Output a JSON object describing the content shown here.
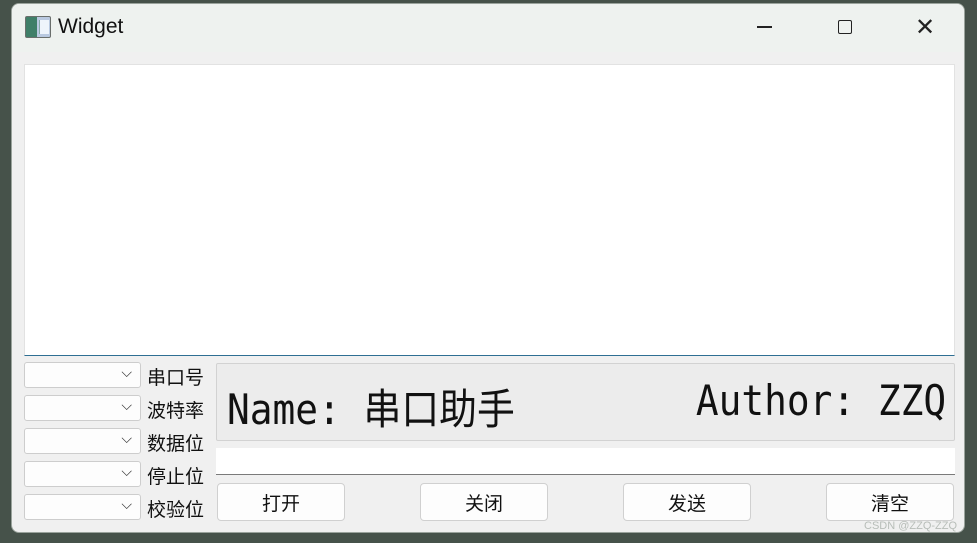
{
  "window": {
    "title": "Widget",
    "controls": {
      "minimize": "minimize-icon",
      "maximize": "maximize-icon",
      "close": "close-icon"
    }
  },
  "receive_area": {
    "value": ""
  },
  "settings": [
    {
      "label": "串口号",
      "value": ""
    },
    {
      "label": "波特率",
      "value": ""
    },
    {
      "label": "数据位",
      "value": ""
    },
    {
      "label": "停止位",
      "value": ""
    },
    {
      "label": "校验位",
      "value": ""
    }
  ],
  "banner": {
    "name": "Name: 串口助手",
    "author": "Author: ZZQ"
  },
  "send_input": {
    "value": ""
  },
  "buttons": {
    "open": "打开",
    "close": "关闭",
    "send": "发送",
    "clear": "清空"
  },
  "watermark": "CSDN @ZZQ-ZZQ"
}
